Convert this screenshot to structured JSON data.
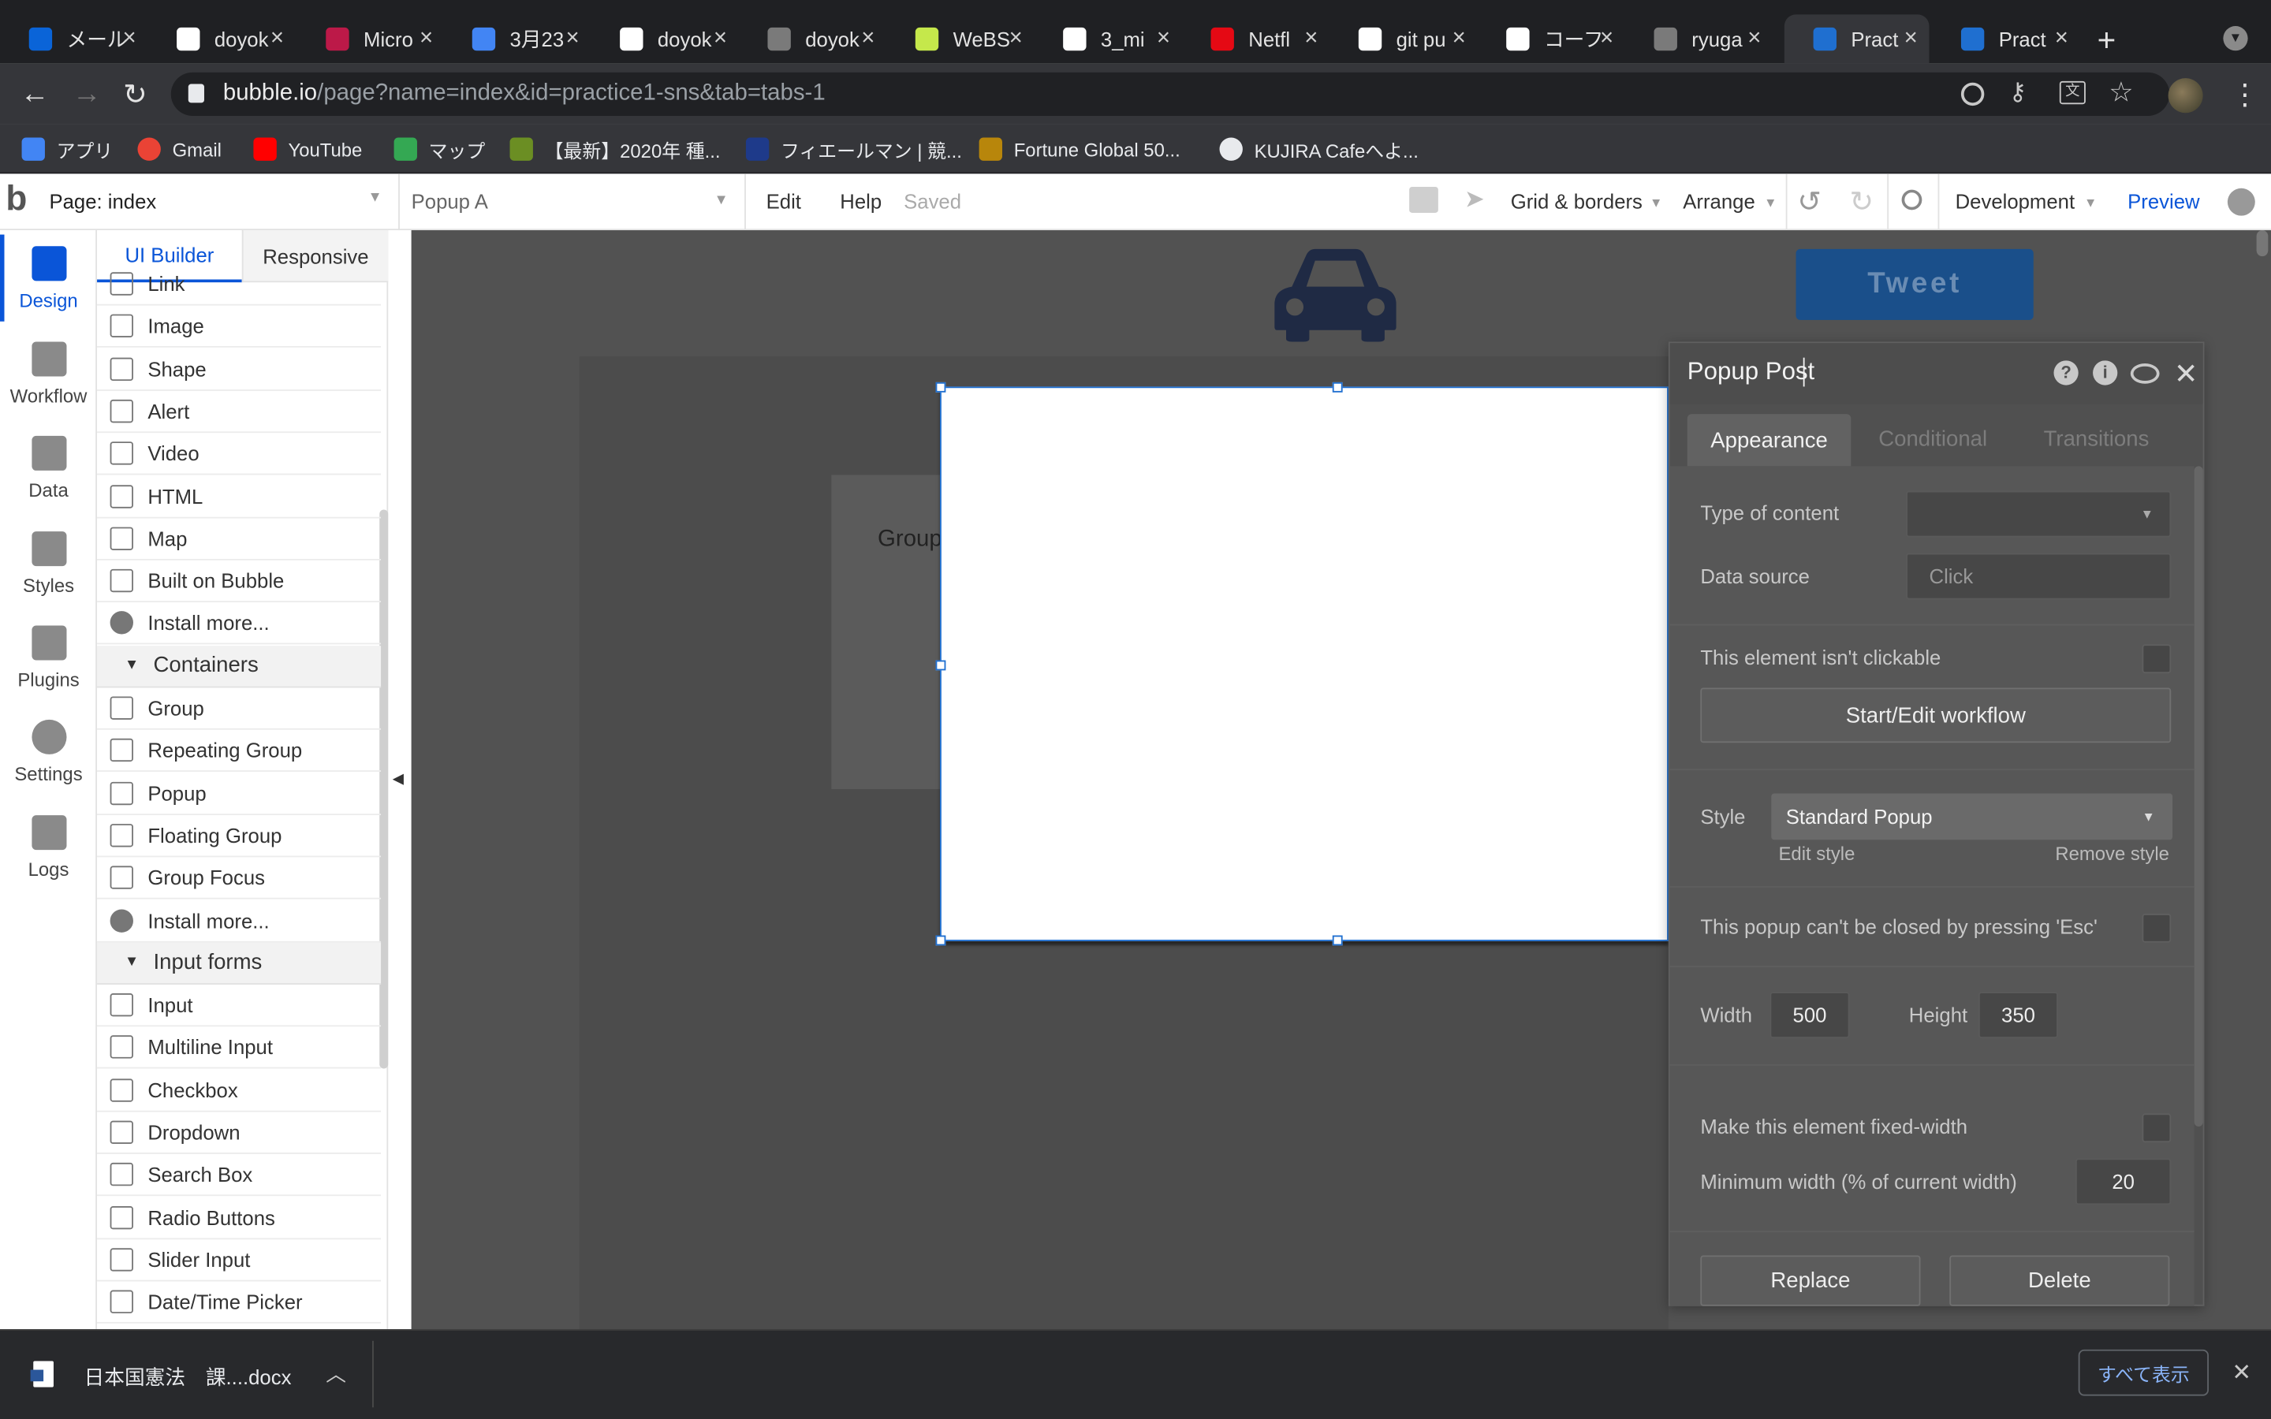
{
  "browser": {
    "tabs": [
      {
        "label": "メール",
        "favicon": "outlook-icon",
        "color": "#0a64d8"
      },
      {
        "label": "doyok",
        "favicon": "github-icon",
        "color": "#ffffff"
      },
      {
        "label": "Micro",
        "favicon": "microsoft-stream-icon",
        "color": "#bc1948"
      },
      {
        "label": "3月23",
        "favicon": "google-docs-icon",
        "color": "#4285f4"
      },
      {
        "label": "doyok",
        "favicon": "wordpress-icon",
        "color": "#ffffff"
      },
      {
        "label": "doyok",
        "favicon": "globe-icon",
        "color": "#7a7a7a"
      },
      {
        "label": "WeBS",
        "favicon": "webs-icon",
        "color": "#c5e84b"
      },
      {
        "label": "3_mi",
        "favicon": "dl-icon",
        "color": "#ffffff"
      },
      {
        "label": "Netfl",
        "favicon": "netflix-icon",
        "color": "#e50914"
      },
      {
        "label": "git pu",
        "favicon": "hatena-icon",
        "color": "#ffffff"
      },
      {
        "label": "コーフ",
        "favicon": "wiki-icon",
        "color": "#ffffff"
      },
      {
        "label": "ryuga",
        "favicon": "globe-icon",
        "color": "#7a7a7a"
      },
      {
        "label": "Pract",
        "favicon": "bubble-icon",
        "color": "#1f6fd0"
      },
      {
        "label": "Pract",
        "favicon": "bubble-icon",
        "color": "#1f6fd0"
      }
    ],
    "active_tab_index": 12,
    "url_domain": "bubble.io",
    "url_path": "/page?name=index&id=practice1-sns&tab=tabs-1",
    "bookmarks": [
      {
        "label": "アプリ",
        "icon": "apps-grid-icon"
      },
      {
        "label": "Gmail",
        "icon": "google-icon"
      },
      {
        "label": "YouTube",
        "icon": "youtube-icon"
      },
      {
        "label": "マップ",
        "icon": "maps-icon"
      },
      {
        "label": "【最新】2020年 種...",
        "icon": "bookmark-site-icon"
      },
      {
        "label": "フィエールマン | 競...",
        "icon": "bookmark-site-icon"
      },
      {
        "label": "Fortune Global 50...",
        "icon": "fortune-icon"
      },
      {
        "label": "KUJIRA Cafeへよ...",
        "icon": "globe-icon"
      }
    ]
  },
  "header": {
    "page_label": "Page: index",
    "element_selector": "Popup A",
    "menu": {
      "edit": "Edit",
      "help": "Help",
      "saved": "Saved"
    },
    "grid_borders": "Grid & borders",
    "arrange": "Arrange",
    "version": "Development",
    "preview": "Preview"
  },
  "rail": {
    "items": [
      {
        "label": "Design",
        "icon": "design-icon"
      },
      {
        "label": "Workflow",
        "icon": "workflow-icon"
      },
      {
        "label": "Data",
        "icon": "database-icon"
      },
      {
        "label": "Styles",
        "icon": "brush-icon"
      },
      {
        "label": "Plugins",
        "icon": "plug-icon"
      },
      {
        "label": "Settings",
        "icon": "gear-icon"
      },
      {
        "label": "Logs",
        "icon": "document-icon"
      }
    ]
  },
  "palette": {
    "tabs": {
      "builder": "UI Builder",
      "responsive": "Responsive"
    },
    "visual_elements": [
      "Link",
      "Image",
      "Shape",
      "Alert",
      "Video",
      "HTML",
      "Map",
      "Built on Bubble",
      "Install more..."
    ],
    "containers_title": "Containers",
    "containers": [
      "Group",
      "Repeating Group",
      "Popup",
      "Floating Group",
      "Group Focus",
      "Install more..."
    ],
    "inputs_title": "Input forms",
    "inputs": [
      "Input",
      "Multiline Input",
      "Checkbox",
      "Dropdown",
      "Search Box",
      "Radio Buttons",
      "Slider Input",
      "Date/Time Picker"
    ]
  },
  "canvas": {
    "tweet_button": "Tweet",
    "group_label": "Group",
    "car_icon": "car-icon"
  },
  "property_editor": {
    "title": "Popup Post",
    "tabs": {
      "appearance": "Appearance",
      "conditional": "Conditional",
      "transitions": "Transitions"
    },
    "type_of_content_label": "Type of content",
    "type_of_content_value": "",
    "data_source_label": "Data source",
    "data_source_placeholder": "Click",
    "not_clickable_label": "This element isn't clickable",
    "not_clickable_checked": false,
    "workflow_button": "Start/Edit workflow",
    "style_label": "Style",
    "style_value": "Standard Popup",
    "edit_style": "Edit style",
    "remove_style": "Remove style",
    "esc_label": "This popup can't be closed by pressing 'Esc'",
    "esc_checked": false,
    "width_label": "Width",
    "width_value": "500",
    "height_label": "Height",
    "height_value": "350",
    "fixed_width_label": "Make this element fixed-width",
    "fixed_width_checked": false,
    "min_width_label": "Minimum width (% of current width)",
    "min_width_value": "20",
    "replace_button": "Replace",
    "delete_button": "Delete"
  },
  "downloads": {
    "filename": "日本国憲法　課....docx",
    "show_all": "すべて表示"
  },
  "colors": {
    "accent": "#0a55d8",
    "tweet": "#1a4f8a"
  }
}
